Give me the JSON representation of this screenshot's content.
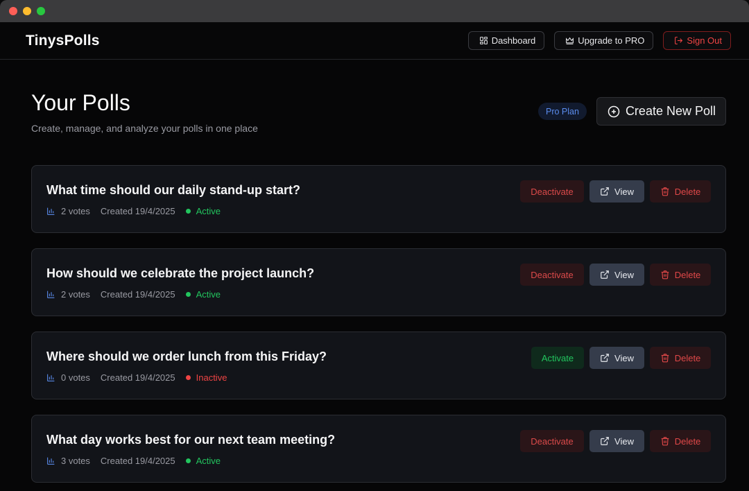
{
  "window": {
    "controls": [
      {
        "name": "close",
        "color": "#ff5f57"
      },
      {
        "name": "minimize",
        "color": "#febc2e"
      },
      {
        "name": "zoom",
        "color": "#28c840"
      }
    ]
  },
  "navbar": {
    "brand": "TinysPolls",
    "dashboard_label": "Dashboard",
    "upgrade_label": "Upgrade to PRO",
    "signout_label": "Sign Out",
    "icons": {
      "dashboard": "grid-icon",
      "upgrade": "crown-icon",
      "signout": "log-out-icon"
    }
  },
  "header": {
    "title": "Your Polls",
    "subtitle": "Create, manage, and analyze your polls in one place",
    "plan_badge": "Pro Plan",
    "create_label": "Create New Poll"
  },
  "polls": [
    {
      "question": "What time should our daily stand-up start?",
      "votes": "2 votes",
      "created": "Created 19/4/2025",
      "status": "Active",
      "toggle_label": "Deactivate",
      "view_label": "View",
      "delete_label": "Delete"
    },
    {
      "question": "How should we celebrate the project launch?",
      "votes": "2 votes",
      "created": "Created 19/4/2025",
      "status": "Active",
      "toggle_label": "Deactivate",
      "view_label": "View",
      "delete_label": "Delete"
    },
    {
      "question": "Where should we order lunch from this Friday?",
      "votes": "0 votes",
      "created": "Created 19/4/2025",
      "status": "Inactive",
      "toggle_label": "Activate",
      "view_label": "View",
      "delete_label": "Delete"
    },
    {
      "question": "What day works best for our next team meeting?",
      "votes": "3 votes",
      "created": "Created 19/4/2025",
      "status": "Active",
      "toggle_label": "Deactivate",
      "view_label": "View",
      "delete_label": "Delete"
    }
  ],
  "colors": {
    "active": "#22c55e",
    "inactive": "#ef4444",
    "accent_blue": "#5b8def",
    "danger": "#ef4444"
  }
}
